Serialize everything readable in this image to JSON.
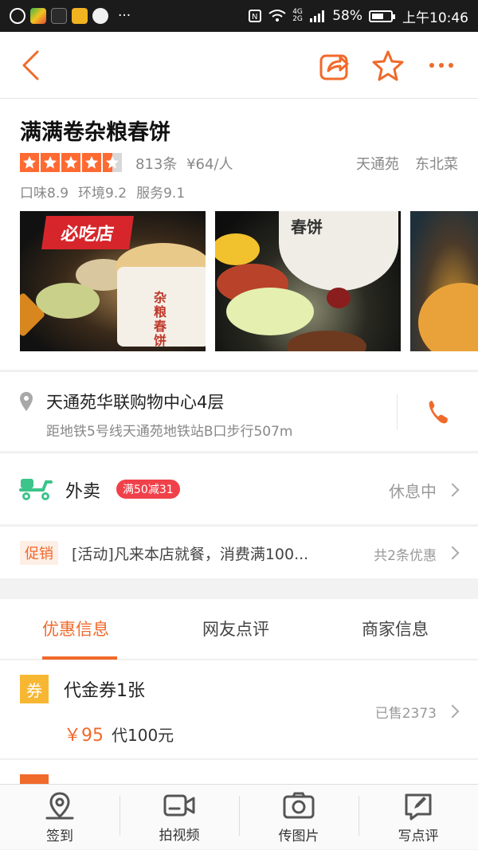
{
  "status_bar": {
    "battery": "58%",
    "time": "上午10:46",
    "signal_label": "4G 2G",
    "more": "···"
  },
  "nav": {
    "back": "back-icon",
    "share": "share-icon",
    "favorite": "star-outline-icon",
    "more": "more-dots-icon"
  },
  "shop": {
    "name": "满满卷杂粮春饼",
    "rating_stars": 4.5,
    "reviews": "813条",
    "price": "¥64/人",
    "area": "天通苑",
    "cuisine": "东北菜",
    "scores": [
      "口味8.9",
      "环境9.2",
      "服务9.1"
    ],
    "photo_badge": "必吃店",
    "photo_text_1": "杂粮春饼",
    "photo_text_2": "春饼"
  },
  "address": {
    "main": "天通苑华联购物中心4层",
    "sub": "距地铁5号线天通苑地铁站B口步行507m"
  },
  "takeout": {
    "label": "外卖",
    "tag": "满50减31",
    "status": "休息中"
  },
  "promo": {
    "tag": "促销",
    "text": "[活动]凡来本店就餐，消费满100...",
    "count": "共2条优惠"
  },
  "tabs": [
    {
      "label": "优惠信息",
      "active": true
    },
    {
      "label": "网友点评",
      "active": false
    },
    {
      "label": "商家信息",
      "active": false
    }
  ],
  "coupon": {
    "icon": "券",
    "title": "代金券1张",
    "price": "￥95",
    "orig": "代100元",
    "sold": "已售2373"
  },
  "bottom_bar": [
    {
      "label": "签到",
      "icon": "location-pin-icon"
    },
    {
      "label": "拍视频",
      "icon": "video-camera-icon"
    },
    {
      "label": "传图片",
      "icon": "camera-icon"
    },
    {
      "label": "写点评",
      "icon": "edit-icon"
    }
  ],
  "colors": {
    "accent": "#f06a2b",
    "star": "#ff6a33",
    "takeout_green": "#3cc48b",
    "tag_red": "#f0414a"
  }
}
